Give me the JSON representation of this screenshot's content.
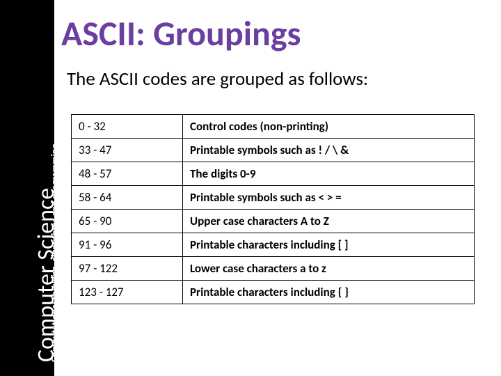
{
  "sidebar": {
    "main": "Computer Science",
    "sub": "Computational thinking, algorithms and programming"
  },
  "title": "ASCII: Groupings",
  "subtitle": "The ASCII codes are grouped as follows:",
  "chart_data": {
    "type": "table",
    "rows": [
      {
        "range": "0 - 32",
        "desc": "Control codes (non-printing)"
      },
      {
        "range": "33 - 47",
        "desc": "Printable symbols such as ! / \\ &"
      },
      {
        "range": "48 - 57",
        "desc": "The digits 0-9"
      },
      {
        "range": "58 - 64",
        "desc": "Printable symbols such as < > ="
      },
      {
        "range": "65 - 90",
        "desc": "Upper case characters A to Z"
      },
      {
        "range": "91 - 96",
        "desc": "Printable characters including [ ]"
      },
      {
        "range": "97 - 122",
        "desc": "Lower case characters a to z"
      },
      {
        "range": "123 - 127",
        "desc": "Printable characters including { }"
      }
    ]
  }
}
